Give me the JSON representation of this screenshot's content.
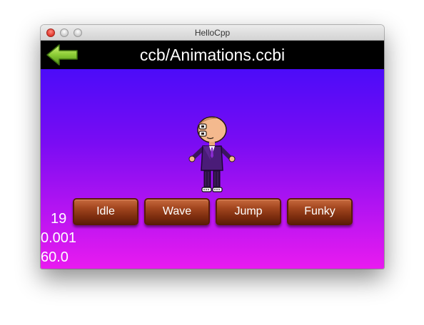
{
  "window": {
    "title": "HelloCpp"
  },
  "scene": {
    "title": "ccb/Animations.ccbi",
    "back_icon": "back-arrow-icon",
    "buttons": [
      {
        "label": "Idle"
      },
      {
        "label": "Wave"
      },
      {
        "label": "Jump"
      },
      {
        "label": "Funky"
      }
    ],
    "stats": {
      "draw_calls": "19",
      "frame_time": "0.001",
      "fps": "60.0"
    }
  },
  "colors": {
    "gradient_top": "#3a0cfb",
    "gradient_bottom": "#e91bf0",
    "button": "#a2461f",
    "arrow": "#7fc02f"
  }
}
